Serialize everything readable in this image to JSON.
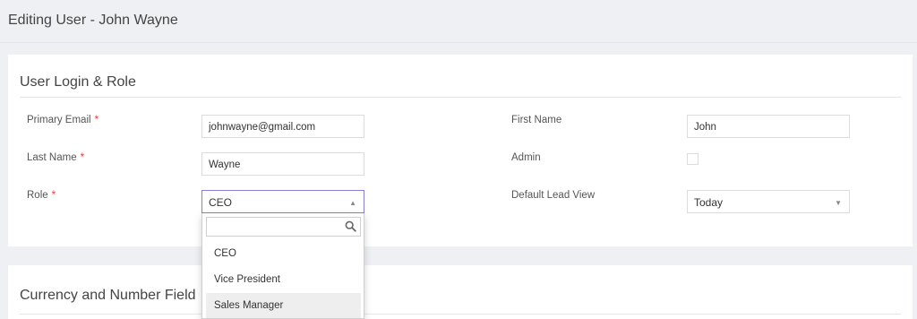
{
  "page": {
    "title": "Editing User - John Wayne"
  },
  "login_section": {
    "title": "User Login & Role",
    "primary_email": {
      "label": "Primary Email",
      "required": "*",
      "value": "johnwayne@gmail.com"
    },
    "last_name": {
      "label": "Last Name",
      "required": "*",
      "value": "Wayne"
    },
    "role": {
      "label": "Role",
      "required": "*",
      "value": "CEO",
      "search_value": "",
      "options": [
        "CEO",
        "Vice President",
        "Sales Manager"
      ],
      "highlighted": "Sales Manager"
    },
    "first_name": {
      "label": "First Name",
      "value": "John"
    },
    "admin": {
      "label": "Admin",
      "checked": false
    },
    "default_lead_view": {
      "label": "Default Lead View",
      "value": "Today"
    }
  },
  "currency_section": {
    "title": "Currency and Number Field"
  },
  "icons": {
    "select_arrow_up": "caret-up-icon",
    "select_arrow_down": "caret-down-icon",
    "search": "search-icon"
  },
  "colors": {
    "required": "#e03b3b",
    "focus_border": "#8e7bd3",
    "highlight": "#eeeeee"
  }
}
